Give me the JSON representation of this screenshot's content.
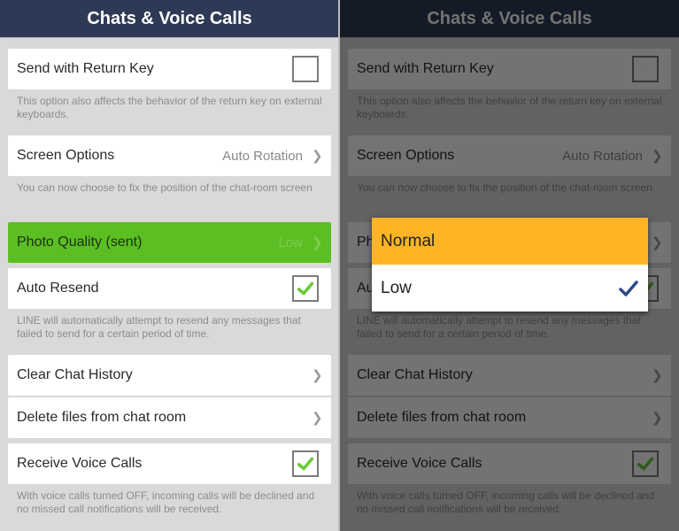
{
  "header": {
    "title": "Chats & Voice Calls"
  },
  "settings": {
    "send_return": {
      "label": "Send with Return Key",
      "checked": false,
      "desc": "This option also affects the behavior of the return key on external keyboards."
    },
    "screen_options": {
      "label": "Screen Options",
      "value": "Auto Rotation",
      "desc": "You can now choose to fix the position of the chat-room screen"
    },
    "photo_quality": {
      "label": "Photo Quality (sent)",
      "value": "Low"
    },
    "auto_resend": {
      "label": "Auto Resend",
      "checked": true,
      "desc": "LINE will automatically attempt to resend any messages that failed to send for a certain period of time."
    },
    "clear_history": {
      "label": "Clear Chat History"
    },
    "delete_files": {
      "label": "Delete files from chat room"
    },
    "voice_calls": {
      "label": "Receive Voice Calls",
      "checked": true,
      "desc": "With voice calls turned OFF, incoming calls will be declined and no missed call notifications will be received."
    }
  },
  "dialog": {
    "options": [
      {
        "label": "Normal",
        "highlighted": true,
        "selected": false
      },
      {
        "label": "Low",
        "highlighted": false,
        "selected": true
      }
    ]
  },
  "colors": {
    "header": "#2e3a55",
    "accent_green": "#5bbf24",
    "highlight_orange": "#fdb524",
    "check_blue": "#2c4a8c"
  }
}
